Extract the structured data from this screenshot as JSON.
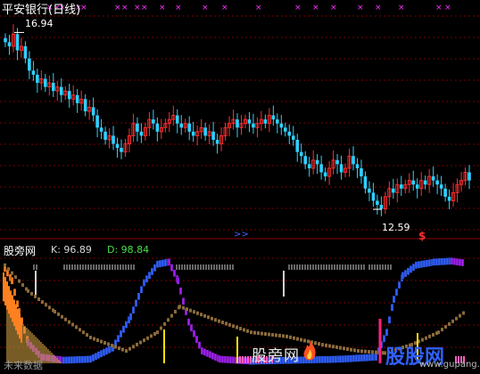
{
  "title": "平安银行(日线)",
  "price_panel": {
    "high_label": "16.94",
    "low_label": "12.59",
    "signal_glyph": "$",
    "marker_glyph": ">>"
  },
  "indicator_panel": {
    "name": "股旁网",
    "k_label": "K: 96.89",
    "d_label": "D: 98.84"
  },
  "watermark": {
    "text1": "股旁网",
    "text2": "股股网",
    "text3": "www.gupang.com rxue.com",
    "text4": "未来数据"
  },
  "colors": {
    "up": "#ff3030",
    "down": "#30d0ff",
    "grid": "#7a0000",
    "cross_marker": "#ff30ff",
    "k_line_blue": "#3060ff",
    "k_line_purple": "#a020f0",
    "fill_orange": "#ff8020",
    "fill_gold": "#c89a40",
    "fill_pink": "#ff60c0",
    "bars_gray": "#d0d0d0",
    "yellow": "#ffe000"
  },
  "chart_data": [
    {
      "type": "candlestick",
      "title": "平安银行(日线)",
      "ylim": [
        12.0,
        17.3
      ],
      "close": [
        16.7,
        16.6,
        16.9,
        16.5,
        16.6,
        16.3,
        16.0,
        15.9,
        15.7,
        15.8,
        15.6,
        15.7,
        15.5,
        15.6,
        15.4,
        15.5,
        15.3,
        15.4,
        15.2,
        15.3,
        15.0,
        15.1,
        14.9,
        14.6,
        14.5,
        14.3,
        14.4,
        14.2,
        14.1,
        14.0,
        14.2,
        14.4,
        14.7,
        14.5,
        14.4,
        14.6,
        14.8,
        14.7,
        14.5,
        14.6,
        14.7,
        14.8,
        14.9,
        14.7,
        14.6,
        14.7,
        14.5,
        14.4,
        14.5,
        14.6,
        14.4,
        14.5,
        14.3,
        14.2,
        14.4,
        14.6,
        14.7,
        14.8,
        14.6,
        14.7,
        14.8,
        14.7,
        14.6,
        14.7,
        14.8,
        14.7,
        14.9,
        14.8,
        14.7,
        14.6,
        14.5,
        14.4,
        14.3,
        14.0,
        13.9,
        13.7,
        13.6,
        13.8,
        13.7,
        13.5,
        13.4,
        13.6,
        13.8,
        13.7,
        13.5,
        13.6,
        13.9,
        13.7,
        13.6,
        13.4,
        13.1,
        13.0,
        12.8,
        12.7,
        12.6,
        12.9,
        13.1,
        13.0,
        13.2,
        13.1,
        13.2,
        13.3,
        13.2,
        13.1,
        13.3,
        13.2,
        13.4,
        13.3,
        13.2,
        13.1,
        12.9,
        12.8,
        13.0,
        13.2,
        13.3,
        13.5,
        13.3
      ]
    },
    {
      "type": "line",
      "name": "股旁网",
      "ylim": [
        0,
        100
      ],
      "series": [
        {
          "name": "K",
          "last": 96.89
        },
        {
          "name": "D",
          "last": 98.84
        }
      ]
    }
  ]
}
